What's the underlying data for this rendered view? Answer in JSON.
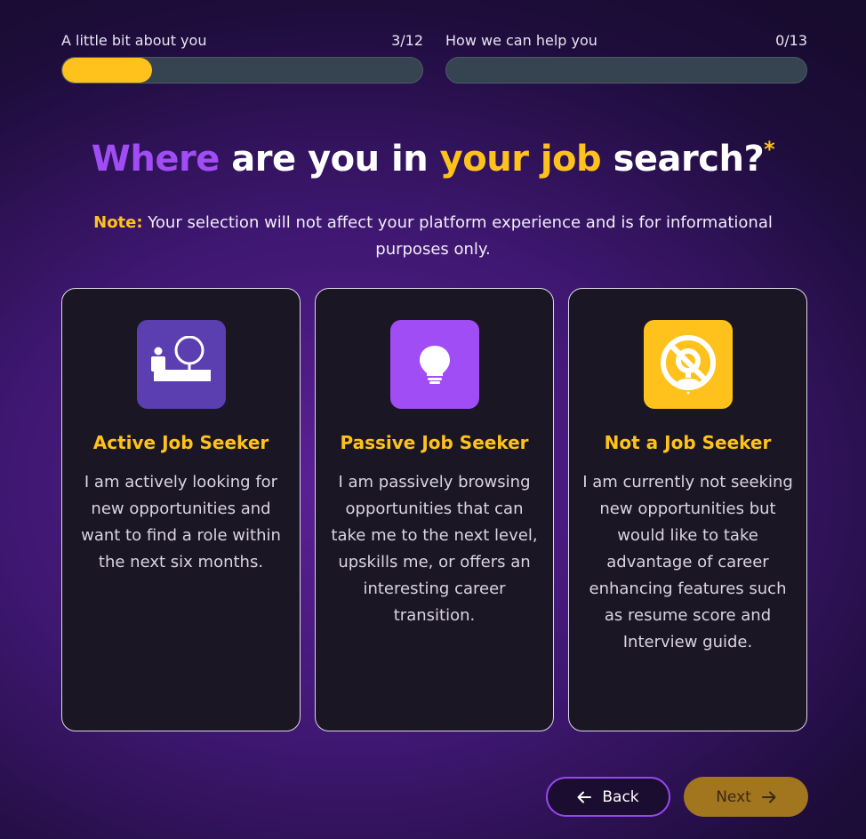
{
  "progress": [
    {
      "label": "A little bit about you",
      "count": "3/12",
      "fraction": 0.25
    },
    {
      "label": "How we can help you",
      "count": "0/13",
      "fraction": 0
    }
  ],
  "heading": {
    "part1": "Where",
    "part2": " are you in ",
    "part3": "your job",
    "part4": " search?",
    "required_mark": "*"
  },
  "note": {
    "label": "Note:",
    "text": " Your selection will not affect your platform experience and is for informational purposes only."
  },
  "options": [
    {
      "title": "Active Job Seeker",
      "description": "I am actively looking for new opportunities and want to find a role within the next six months.",
      "icon": "active-seeker-icon",
      "icon_bg": "#5b3fb0"
    },
    {
      "title": "Passive Job Seeker",
      "description": "I am passively browsing opportunities that can take me to the next level, upskills me, or offers an interesting career transition.",
      "icon": "lightbulb-icon",
      "icon_bg": "#a14df5"
    },
    {
      "title": "Not a Job Seeker",
      "description": "I am currently not seeking new opportunities but would like to take advantage of career enhancing features such as resume score and Interview guide.",
      "icon": "no-search-icon",
      "icon_bg": "#ffc21c"
    }
  ],
  "buttons": {
    "back": "Back",
    "next": "Next"
  },
  "colors": {
    "accent_yellow": "#ffc21c",
    "accent_purple": "#a14df5"
  }
}
